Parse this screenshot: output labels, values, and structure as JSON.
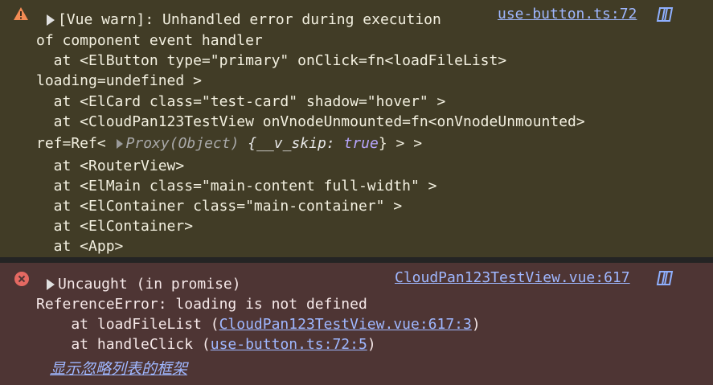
{
  "warning": {
    "title": "[Vue warn]: Unhandled error during execution",
    "title2": "of component event handler",
    "source": "use-button.ts:72",
    "trace": [
      "  at <ElButton type=\"primary\" onClick=fn<loadFileList>",
      "loading=undefined >",
      "  at <ElCard class=\"test-card\" shadow=\"hover\" >",
      "  at <CloudPan123TestView onVnodeUnmounted=fn<onVnodeUnmounted>"
    ],
    "ref_prefix": "ref=Ref< ",
    "proxy_text": "Proxy(Object)",
    "skip_open": " {__v_skip: ",
    "skip_value": "true",
    "skip_close": "} > >",
    "trace2": [
      "  at <RouterView>",
      "  at <ElMain class=\"main-content full-width\" >",
      "  at <ElContainer class=\"main-container\" >",
      "  at <ElContainer>",
      "  at <App>"
    ]
  },
  "error": {
    "title": "Uncaught (in promise)",
    "source": "CloudPan123TestView.vue:617",
    "message": "ReferenceError: loading is not defined",
    "frame1_prefix": "    at loadFileList (",
    "frame1_link": "CloudPan123TestView.vue:617:3",
    "frame1_suffix": ")",
    "frame2_prefix": "    at handleClick (",
    "frame2_link": "use-button.ts:72:5",
    "frame2_suffix": ")",
    "ignored_link": "显示忽略列表的框架"
  },
  "colors": {
    "warning_bg": "#413c26",
    "error_bg": "#4e3534",
    "link": "#9fb7ff"
  }
}
